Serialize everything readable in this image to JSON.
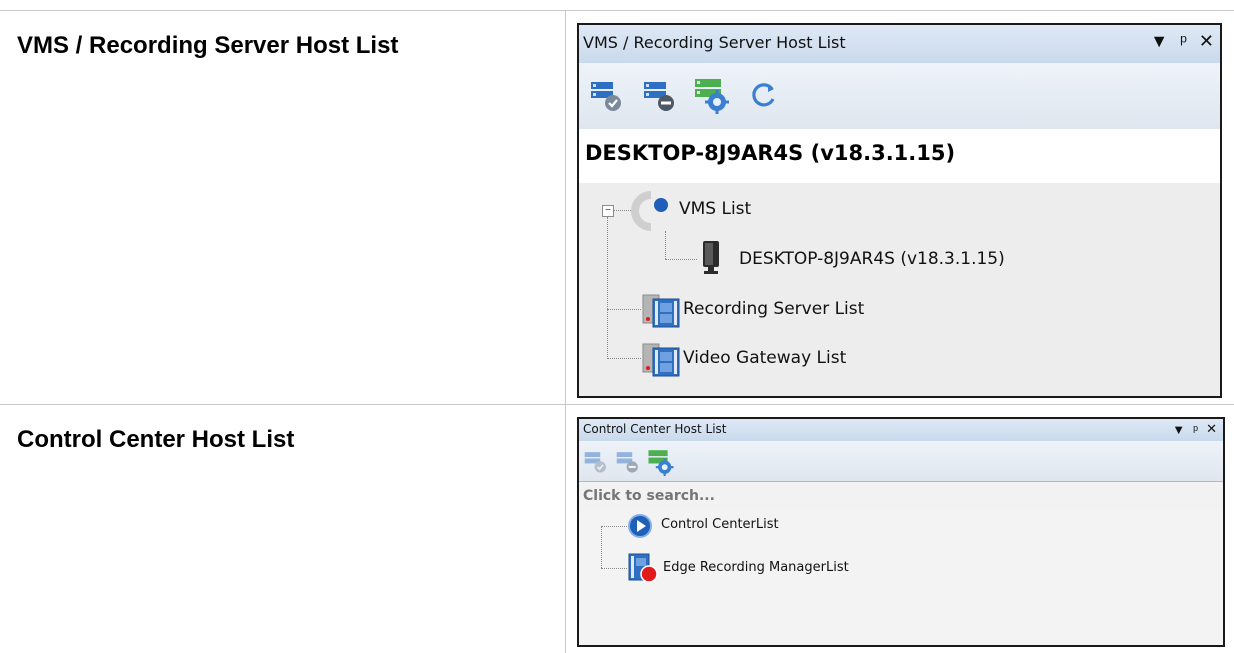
{
  "rows": [
    {
      "label": "VMS / Recording Server Host List"
    },
    {
      "label": "Control Center Host List"
    }
  ],
  "vms_panel": {
    "title": "VMS / Recording Server Host List",
    "toolbar_icons": [
      "connect-server-icon",
      "disconnect-server-icon",
      "server-settings-icon",
      "refresh-icon"
    ],
    "host_header": "DESKTOP-8J9AR4S (v18.3.1.15)",
    "tree": {
      "vms_list": "VMS List",
      "vms_child": "DESKTOP-8J9AR4S (v18.3.1.15)",
      "recording_server_list": "Recording Server List",
      "video_gateway_list": "Video Gateway List"
    }
  },
  "cc_panel": {
    "title": "Control Center Host List",
    "toolbar_icons": [
      "connect-server-icon",
      "disconnect-server-icon",
      "server-settings-icon"
    ],
    "search_placeholder": "Click to search...",
    "tree": {
      "control_center_list": "Control CenterList",
      "edge_recording_manager_list": "Edge Recording ManagerList"
    }
  },
  "colors": {
    "accent_blue": "#1f5fb8",
    "record_red": "#e11b1b",
    "title_bg": "#d3e0ef"
  }
}
